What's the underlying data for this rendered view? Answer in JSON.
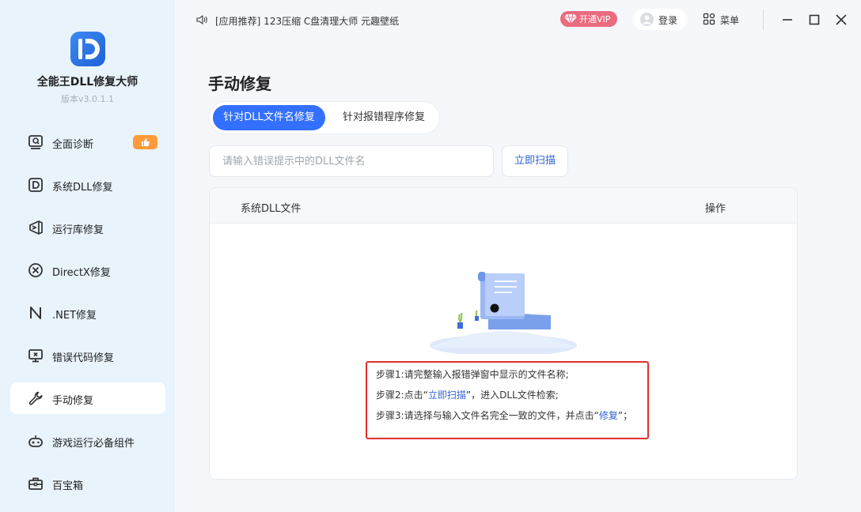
{
  "app": {
    "name": "全能王DLL修复大师",
    "version": "版本v3.0.1.1"
  },
  "sidebar": {
    "items": [
      {
        "label": "全面诊断",
        "icon": "scan-icon",
        "badge": "thumbs-up-icon"
      },
      {
        "label": "系统DLL修复",
        "icon": "dll-icon"
      },
      {
        "label": "运行库修复",
        "icon": "runtime-icon"
      },
      {
        "label": "DirectX修复",
        "icon": "directx-icon"
      },
      {
        "label": ".NET修复",
        "icon": "dotnet-icon"
      },
      {
        "label": "错误代码修复",
        "icon": "error-code-icon"
      },
      {
        "label": "手动修复",
        "icon": "wrench-icon",
        "active": true
      },
      {
        "label": "游戏运行必备组件",
        "icon": "gamepad-icon"
      },
      {
        "label": "百宝箱",
        "icon": "toolbox-icon"
      }
    ]
  },
  "topbar": {
    "announcement": "[应用推荐] 123压缩 C盘清理大师 元趣壁纸",
    "vip_label": "开通VIP",
    "login_label": "登录",
    "menu_label": "菜单"
  },
  "main": {
    "title": "手动修复",
    "tabs": [
      {
        "label": "针对DLL文件名修复",
        "active": true
      },
      {
        "label": "针对报错程序修复",
        "active": false
      }
    ],
    "search": {
      "placeholder": "请输入错误提示中的DLL文件名",
      "value": "",
      "button_label": "立即扫描"
    },
    "table": {
      "columns": [
        "系统DLL文件",
        "操作"
      ]
    },
    "steps": [
      {
        "text": "步骤1:请完整输入报错弹窗中显示的文件名称;"
      },
      {
        "before": "步骤2:点击“",
        "highlight": "立即扫描",
        "after": "”，进入DLL文件检索;"
      },
      {
        "before": "步骤3:请选择与输入文件名完全一致的文件，并点击“",
        "highlight": "修复",
        "after": "”；"
      }
    ]
  },
  "colors": {
    "accent": "#3370ff",
    "link": "#2f63d8",
    "sidebar_bg": "#e9f3fb",
    "highlight_border": "#e03030",
    "vip": "#eb6b7f",
    "badge": "#ff9b3a"
  }
}
